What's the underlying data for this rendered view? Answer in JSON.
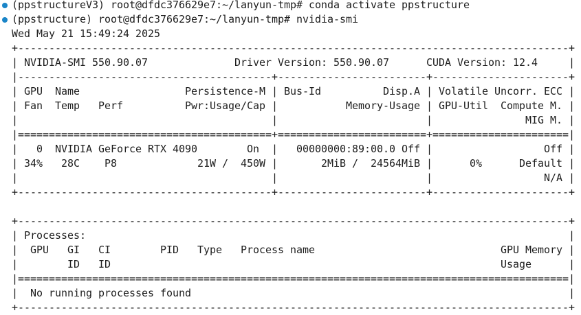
{
  "terminal": {
    "prompt_marker_color": "#1a85c8",
    "prompt_marker_icon": "circle-dot-icon",
    "lines": [
      {
        "text": "(ppstructureV3) root@dfdc376629e7:~/lanyun-tmp# conda activate ppstructure",
        "prompt": true
      },
      {
        "text": "(ppstructure) root@dfdc376629e7:~/lanyun-tmp# nvidia-smi",
        "prompt": true
      },
      {
        "text": "Wed May 21 15:49:24 2025",
        "prompt": false
      },
      {
        "text": "+-----------------------------------------------------------------------------------------+",
        "prompt": false
      },
      {
        "text": "| NVIDIA-SMI 550.90.07              Driver Version: 550.90.07      CUDA Version: 12.4     |",
        "prompt": false
      },
      {
        "text": "|-----------------------------------------+------------------------+----------------------+",
        "prompt": false
      },
      {
        "text": "| GPU  Name                 Persistence-M | Bus-Id          Disp.A | Volatile Uncorr. ECC |",
        "prompt": false
      },
      {
        "text": "| Fan  Temp   Perf          Pwr:Usage/Cap |           Memory-Usage | GPU-Util  Compute M. |",
        "prompt": false
      },
      {
        "text": "|                                         |                        |               MIG M. |",
        "prompt": false
      },
      {
        "text": "|=========================================+========================+======================|",
        "prompt": false
      },
      {
        "text": "|   0  NVIDIA GeForce RTX 4090        On  |   00000000:89:00.0 Off |                  Off |",
        "prompt": false
      },
      {
        "text": "| 34%   28C    P8             21W /  450W |       2MiB /  24564MiB |      0%      Default |",
        "prompt": false
      },
      {
        "text": "|                                         |                        |                  N/A |",
        "prompt": false
      },
      {
        "text": "+-----------------------------------------+------------------------+----------------------+",
        "prompt": false
      },
      {
        "text": "",
        "prompt": false
      },
      {
        "text": "+-----------------------------------------------------------------------------------------+",
        "prompt": false
      },
      {
        "text": "| Processes:                                                                              |",
        "prompt": false
      },
      {
        "text": "|  GPU   GI   CI        PID   Type   Process name                              GPU Memory |",
        "prompt": false
      },
      {
        "text": "|        ID   ID                                                               Usage      |",
        "prompt": false
      },
      {
        "text": "|=========================================================================================|",
        "prompt": false
      },
      {
        "text": "|  No running processes found                                                             |",
        "prompt": false
      },
      {
        "text": "+-----------------------------------------------------------------------------------------+",
        "prompt": false
      }
    ]
  }
}
